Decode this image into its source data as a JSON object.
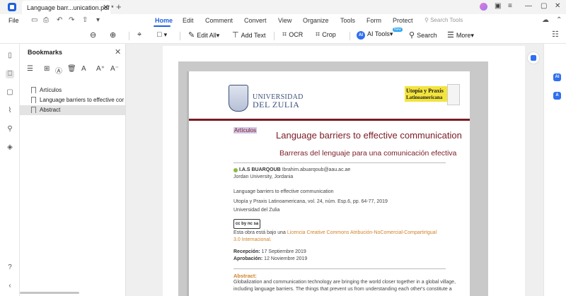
{
  "titlebar": {
    "tab_title": "Language barr...unication.pdf *",
    "tab_close": "✕",
    "tab_add": "+",
    "icons": [
      "app-logo",
      "avatar",
      "message-icon",
      "menu-icon",
      "minimize-icon",
      "maximize-icon",
      "close-icon"
    ]
  },
  "menubar": {
    "file": "File",
    "items": [
      "Home",
      "Edit",
      "Comment",
      "Convert",
      "View",
      "Organize",
      "Tools",
      "Form",
      "Protect"
    ],
    "active": "Home",
    "search_placeholder": "Search Tools"
  },
  "toolbar": {
    "edit_all": "Edit All",
    "add_text": "Add Text",
    "ocr": "OCR",
    "crop": "Crop",
    "ai_tools": "AI Tools",
    "ai_badge": "AI",
    "new_badge": "New",
    "search": "Search",
    "more": "More"
  },
  "bookmarks": {
    "title": "Bookmarks",
    "close": "✕",
    "items": [
      {
        "label": "Artículos",
        "selected": false
      },
      {
        "label": "Language barriers to effective cor",
        "selected": false
      },
      {
        "label": "Abstract",
        "selected": true
      }
    ]
  },
  "document": {
    "logo_left_line1": "UNIVERSIDAD",
    "logo_left_line2": "DEL ZULIA",
    "logo_right_line1": "Utopía y Praxis",
    "logo_right_line2": "Latinoamericana",
    "section_tag": "Artículos",
    "title_en": "Language barriers to effective communication",
    "title_es": "Barreras del lenguaje para una comunicación efectiva",
    "author_name": "I.A.S BUARQOUB",
    "author_email": "Ibrahim.abuarqoub@aau.ac.ae",
    "affiliation": "Jordan University, Jordania",
    "ref_title": "Language barriers to effective communication",
    "ref_journal": "Utopía y Praxis Latinoamericana, vol. 24, núm. Esp.6, pp. 64-77, 2019",
    "ref_publisher": "Universidad del Zulia",
    "cc_label": "cc by nc sa",
    "license_prefix": "Esta obra está bajo una ",
    "license_link_1": "Licencia Creative Commons Atribución-NoComercial-CompartirIgual",
    "license_link_2": "3.0 Internacional.",
    "received_label": "Recepción:",
    "received_date": " 17 Septiembre 2019",
    "approved_label": "Aprobación:",
    "approved_date": " 12 Noviembre 2019",
    "abstract_heading": "Abstract:",
    "abstract_line1": "Globalization and communication technology are bringing the world closer together in a global village,",
    "abstract_line2": "including language barriers. The things that prevent us from understanding each other's constitute a"
  },
  "colors": {
    "accent": "#1f5fe0",
    "journal_red": "#7a1b24",
    "link_orange": "#d1802a",
    "journal_yellow": "#f3e43d"
  }
}
